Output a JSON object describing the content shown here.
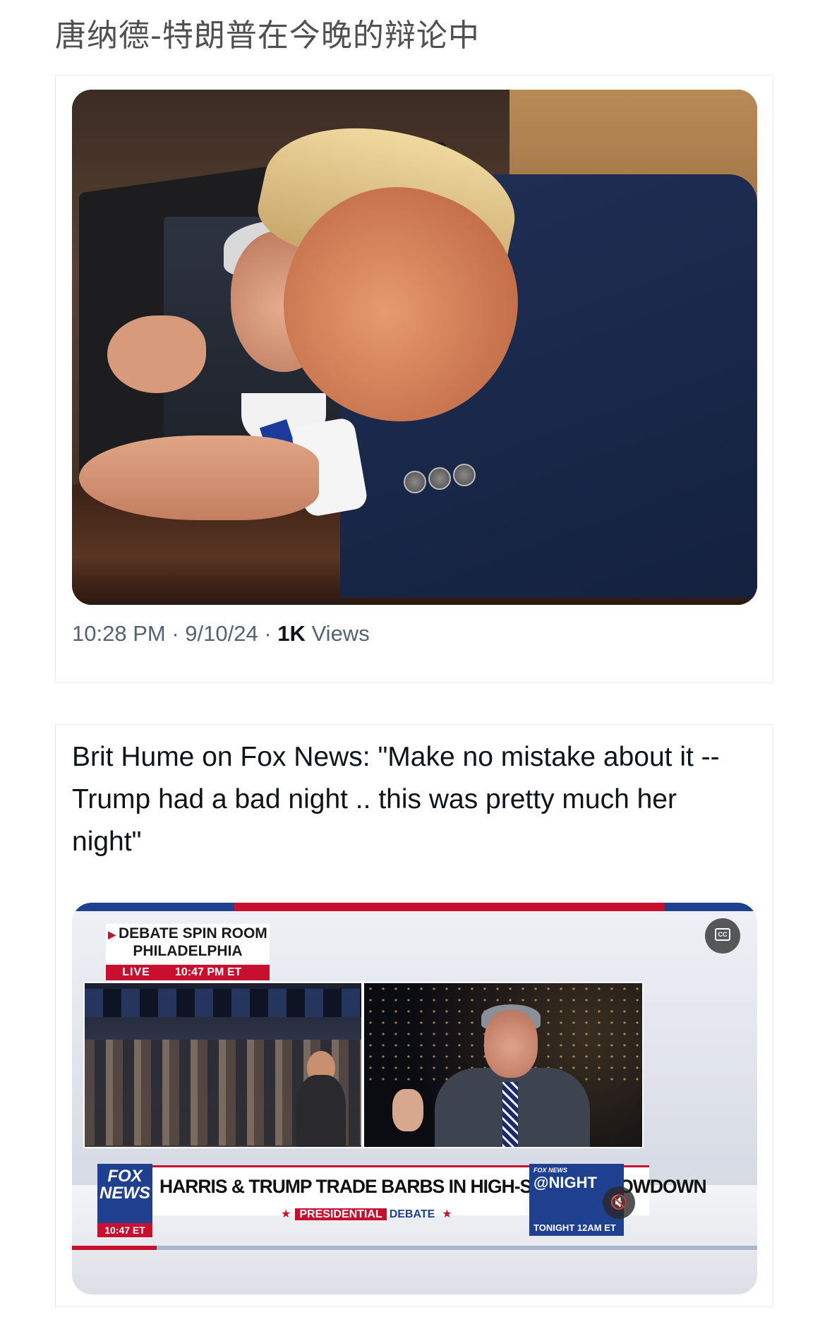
{
  "page": {
    "title": "唐纳德-特朗普在今晚的辩论中"
  },
  "post1": {
    "time": "10:28 PM",
    "date": "9/10/24",
    "separator": "·",
    "views_count": "1K",
    "views_label": "Views"
  },
  "post2": {
    "text": "Brit Hume on Fox News: \"Make no mistake about it -- Trump had a bad night .. this was pretty much her night\"",
    "video": {
      "spin_room_line1": "DEBATE SPIN ROOM",
      "spin_room_line2": "PHILADELPHIA",
      "live": "LIVE",
      "live_time": "10:47 PM ET",
      "fox_logo_line1": "FOX",
      "fox_logo_line2": "NEWS",
      "fox_time": "10:47 ET",
      "headline": "HARRIS & TRUMP TRADE BARBS IN HIGH-STAKES SHOWDOWN",
      "banner_presidential": "PRESIDENTIAL",
      "banner_debate": "DEBATE",
      "night_small": "FOX NEWS",
      "night_big": "@NIGHT",
      "night_tonight": "TONIGHT 12AM ET",
      "cc_icon": "closed-captions-icon",
      "mute_icon": "speaker-muted-icon"
    }
  },
  "colors": {
    "text_primary": "#0f1419",
    "text_secondary": "#536471",
    "fox_red": "#c8102e",
    "fox_blue": "#1f3f8f"
  }
}
